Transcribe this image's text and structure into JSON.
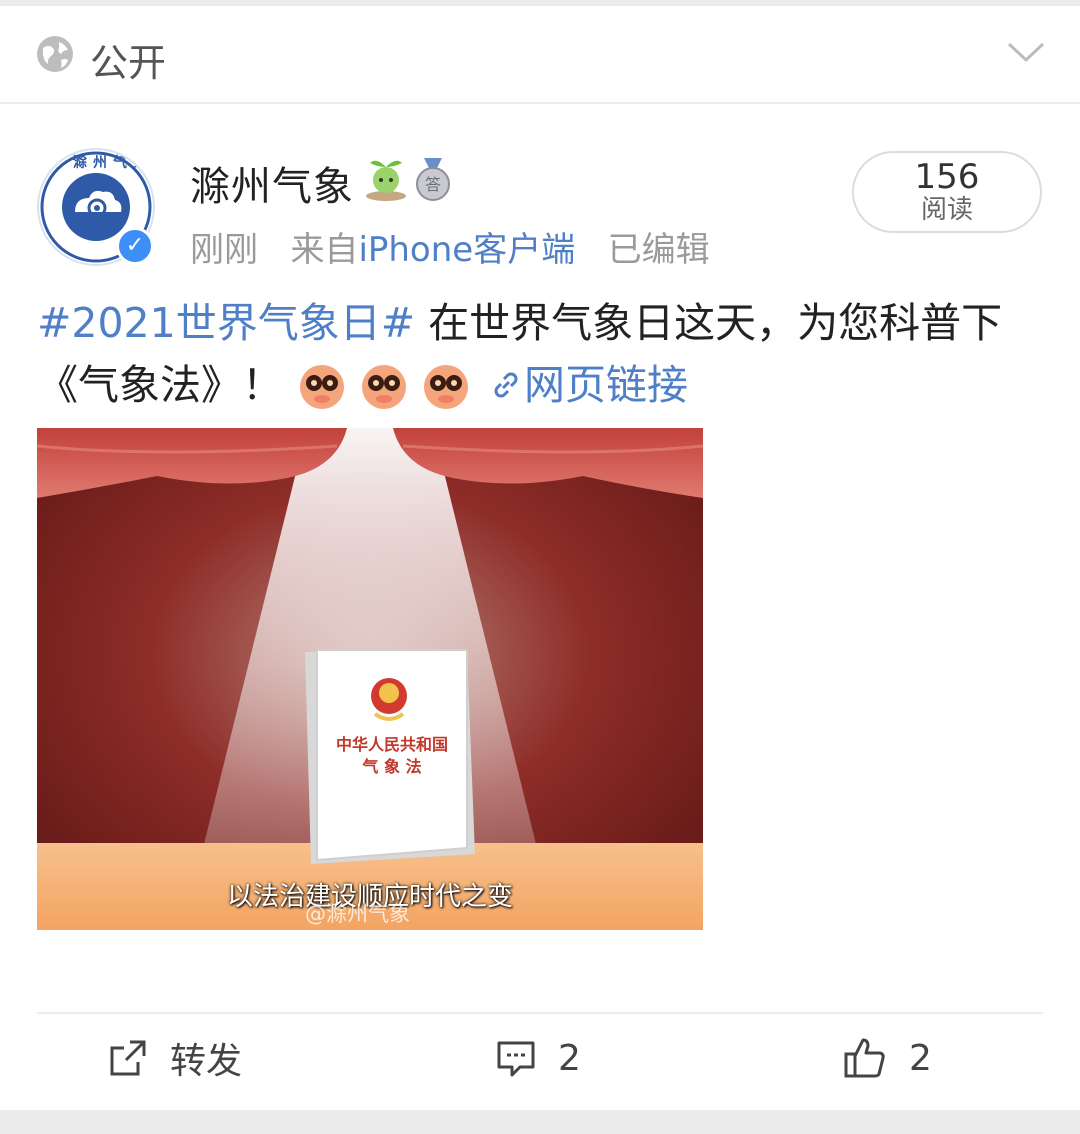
{
  "visibility": {
    "label": "公开"
  },
  "post": {
    "user_name": "滁州气象",
    "meta_time": "刚刚",
    "meta_from": "来自",
    "meta_source": "iPhone客户端",
    "meta_edited": "已编辑",
    "read_count": "156",
    "read_label": "阅读",
    "hashtag": "#2021世界气象日#",
    "text_line1": " 在世界气象日这天，为您科普下",
    "text_line2": "《气象法》！ ",
    "link_label": "网页链接",
    "image": {
      "book_title_line1": "中华人民共和国",
      "book_title_line2": "气 象 法",
      "caption": "以法治建设顺应时代之变",
      "watermark": "@滁州气象"
    },
    "avatar_text": "滁州气象"
  },
  "actions": {
    "repost_label": "转发",
    "comment_count": "2",
    "like_count": "2"
  },
  "colors": {
    "link_blue": "#4f7fc7",
    "verified_blue": "#3e8ef7",
    "curtain_red": "#8c2a26"
  }
}
